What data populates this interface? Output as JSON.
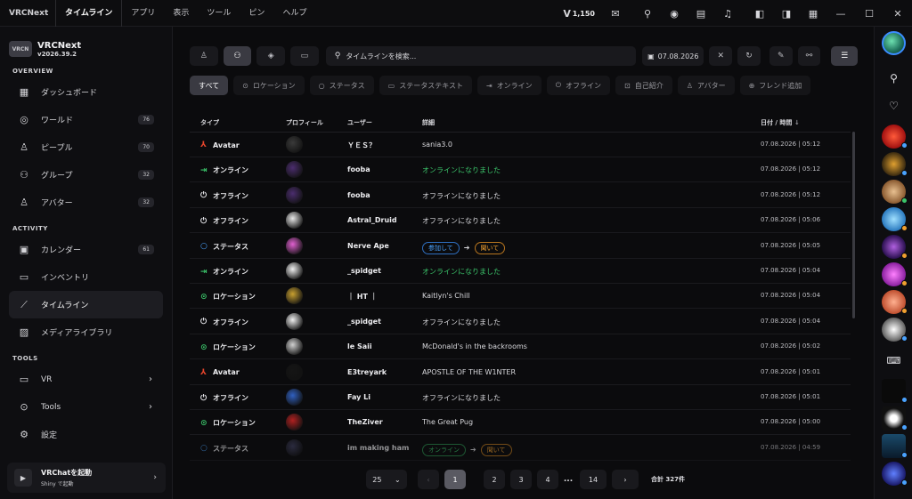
{
  "titlebar": {
    "app": "VRCNext",
    "menu": [
      "タイムライン",
      "アプリ",
      "表示",
      "ツール",
      "ピン",
      "ヘルプ"
    ],
    "vcount": "1,150"
  },
  "sidebar": {
    "brand_logo": "VRCN",
    "brand": "VRCNext",
    "version": "v2026.39.2",
    "overview_header": "OVERVIEW",
    "overview": [
      {
        "icon": "dashboard-icon",
        "label": "ダッシュボード",
        "badge": ""
      },
      {
        "icon": "world-icon",
        "label": "ワールド",
        "badge": "76"
      },
      {
        "icon": "people-icon",
        "label": "ピープル",
        "badge": "70"
      },
      {
        "icon": "group-icon",
        "label": "グループ",
        "badge": "32"
      },
      {
        "icon": "avatar-icon",
        "label": "アバター",
        "badge": "32"
      }
    ],
    "activity_header": "ACTIVITY",
    "activity": [
      {
        "icon": "calendar-icon",
        "label": "カレンダー",
        "badge": "61"
      },
      {
        "icon": "inventory-icon",
        "label": "インベントリ",
        "badge": ""
      },
      {
        "icon": "timeline-icon",
        "label": "タイムライン",
        "badge": ""
      },
      {
        "icon": "media-library-icon",
        "label": "メディアライブラリ",
        "badge": ""
      }
    ],
    "tools_header": "TOOLS",
    "tools": [
      {
        "icon": "vr-icon",
        "label": "VR"
      },
      {
        "icon": "tools-icon",
        "label": "Tools"
      },
      {
        "icon": "gear-icon",
        "label": "設定"
      }
    ],
    "launch": {
      "title": "VRChatを起動",
      "subtitle": "Shiny で起動"
    }
  },
  "toolbar": {
    "search_placeholder": "タイムラインを検索...",
    "date": "07.08.2026"
  },
  "filters": [
    {
      "label": "すべて",
      "icon": ""
    },
    {
      "label": "ロケーション",
      "icon": "⊙"
    },
    {
      "label": "ステータス",
      "icon": "○"
    },
    {
      "label": "ステータステキスト",
      "icon": "▭"
    },
    {
      "label": "オンライン",
      "icon": "⇥"
    },
    {
      "label": "オフライン",
      "icon": "⏻"
    },
    {
      "label": "自己紹介",
      "icon": "⊡"
    },
    {
      "label": "アバター",
      "icon": "♙"
    },
    {
      "label": "フレンド追加",
      "icon": "⊕"
    }
  ],
  "table": {
    "headers": {
      "type": "タイプ",
      "profile": "プロフィール",
      "user": "ユーザー",
      "detail": "詳細",
      "date": "日付 / 時間"
    },
    "rows": [
      {
        "type": "Avatar",
        "kind": "avatar",
        "user": "ＹＥＳ？",
        "detail": "sania3.0",
        "date": "07.08.2026 | 05:12",
        "av": "#3a3a3a"
      },
      {
        "type": "オンライン",
        "kind": "online",
        "user": "fooba",
        "detail": "オンラインになりました",
        "date": "07.08.2026 | 05:12",
        "av": "#4b2d6e"
      },
      {
        "type": "オフライン",
        "kind": "offline",
        "user": "fooba",
        "detail": "オフラインになりました",
        "date": "07.08.2026 | 05:12",
        "av": "#4b2d6e"
      },
      {
        "type": "オフライン",
        "kind": "offline",
        "user": "Astral_Druid",
        "detail": "オフラインになりました",
        "date": "07.08.2026 | 05:06",
        "av": "#e8e8e8"
      },
      {
        "type": "ステータス",
        "kind": "status",
        "user": "Nerve Ape",
        "from": "参加して",
        "to": "聞いて",
        "date": "07.08.2026 | 05:05",
        "av": "#e060d0"
      },
      {
        "type": "オンライン",
        "kind": "online",
        "user": "_spidget",
        "detail": "オンラインになりました",
        "date": "07.08.2026 | 05:04",
        "av": "#f0f0f0"
      },
      {
        "type": "ロケーション",
        "kind": "location",
        "user": "｜ HT ｜",
        "detail": "Kaitlyn's Chill",
        "date": "07.08.2026 | 05:04",
        "av": "#c8a030"
      },
      {
        "type": "オフライン",
        "kind": "offline",
        "user": "_spidget",
        "detail": "オフラインになりました",
        "date": "07.08.2026 | 05:04",
        "av": "#f0f0f0"
      },
      {
        "type": "ロケーション",
        "kind": "location",
        "user": "le Saii",
        "detail": "McDonald's in the backrooms",
        "date": "07.08.2026 | 05:02",
        "av": "#d0d0d0"
      },
      {
        "type": "Avatar",
        "kind": "avatar",
        "user": "E3treyark",
        "detail": "APOSTLE OF THE W1NTER",
        "date": "07.08.2026 | 05:01",
        "av": "#151515"
      },
      {
        "type": "オフライン",
        "kind": "offline",
        "user": "Fay Li",
        "detail": "オフラインになりました",
        "date": "07.08.2026 | 05:01",
        "av": "#3060c0"
      },
      {
        "type": "ロケーション",
        "kind": "location",
        "user": "TheZiver",
        "detail": "The Great Pug",
        "date": "07.08.2026 | 05:00",
        "av": "#b02020"
      },
      {
        "type": "ステータス",
        "kind": "status",
        "user": "im making ham",
        "from": "オンライン",
        "to": "聞いて",
        "date": "07.08.2026 | 04:59",
        "av": "#404060"
      }
    ]
  },
  "pager": {
    "size": "25",
    "pages": [
      "1",
      "2",
      "3",
      "4",
      "14"
    ],
    "dots": "...",
    "total": "合計 327件"
  },
  "colors": {
    "accent": "#3a3a42",
    "online": "#3bc46a",
    "avatar": "#e8452c",
    "status": "#4aa3ff",
    "location": "#3bc46a"
  }
}
